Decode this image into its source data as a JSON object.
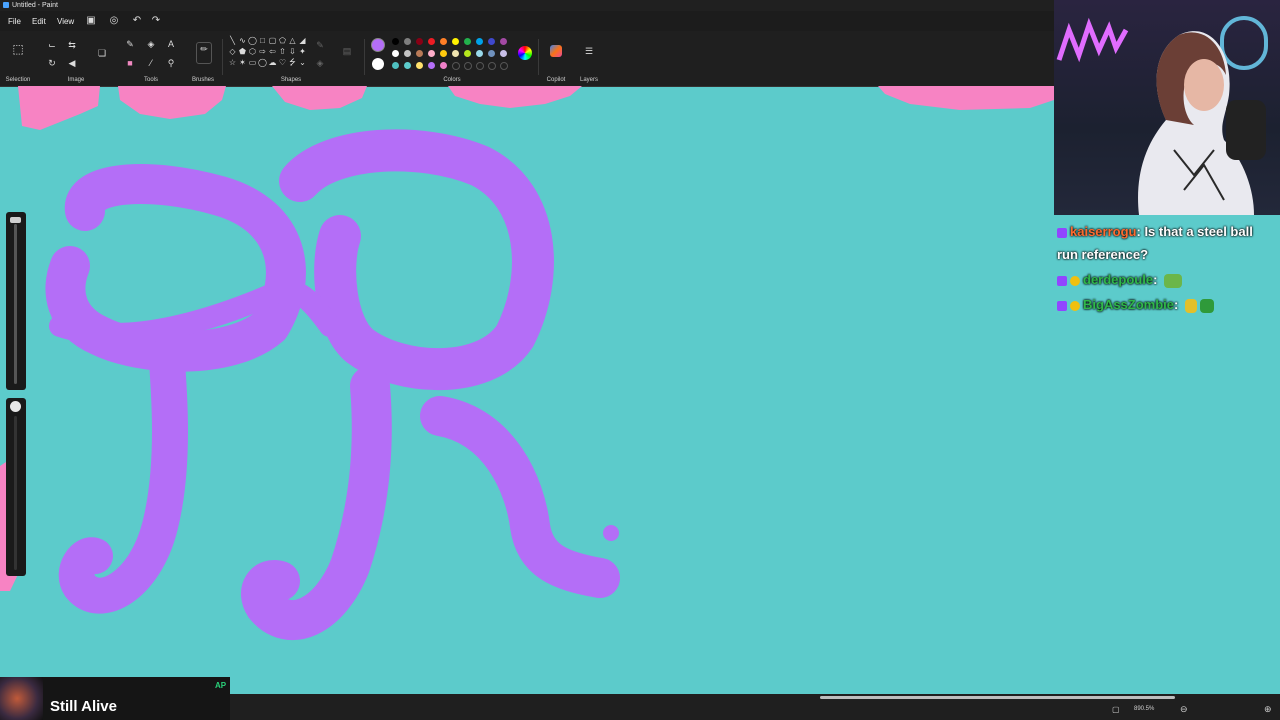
{
  "window": {
    "title": "Untitled - Paint"
  },
  "menu": {
    "file": "File",
    "edit": "Edit",
    "view": "View"
  },
  "ribbon": {
    "selection": "Selection",
    "image": "Image",
    "tools": "Tools",
    "brushes": "Brushes",
    "shapes": "Shapes",
    "colors": "Colors",
    "copilot": "Copilot",
    "layers": "Layers"
  },
  "palette": {
    "active_primary": "#b46ef7",
    "active_secondary": "#ffffff",
    "row1": [
      "#000000",
      "#7f7f7f",
      "#880015",
      "#ed1c24",
      "#ff7f27",
      "#fff200",
      "#22b14c",
      "#00a2e8",
      "#3f48cc",
      "#a349a4"
    ],
    "row2": [
      "#ffffff",
      "#c3c3c3",
      "#b97a57",
      "#ffaec9",
      "#ffc90e",
      "#efe4b0",
      "#b5e61d",
      "#99d9ea",
      "#7092be",
      "#c8bfe7"
    ],
    "row3": [
      "#4fc1c1",
      "#5ccbcb",
      "#ffe06b",
      "#b46ef7",
      "#f080c8"
    ]
  },
  "canvas": {
    "background": "#5ccbcb",
    "stroke_color": "#b46ef7",
    "accent_color": "#f783c3"
  },
  "chat": {
    "messages": [
      {
        "user": "kaiserrogu",
        "text": "Is that a steel ball run reference?"
      },
      {
        "user": "derdepoule",
        "text": ""
      },
      {
        "user": "BigAssZombie",
        "text": ""
      }
    ]
  },
  "status": {
    "zoom": "890.5%"
  },
  "now_playing": {
    "title": "Still Alive",
    "tag": "AP"
  }
}
